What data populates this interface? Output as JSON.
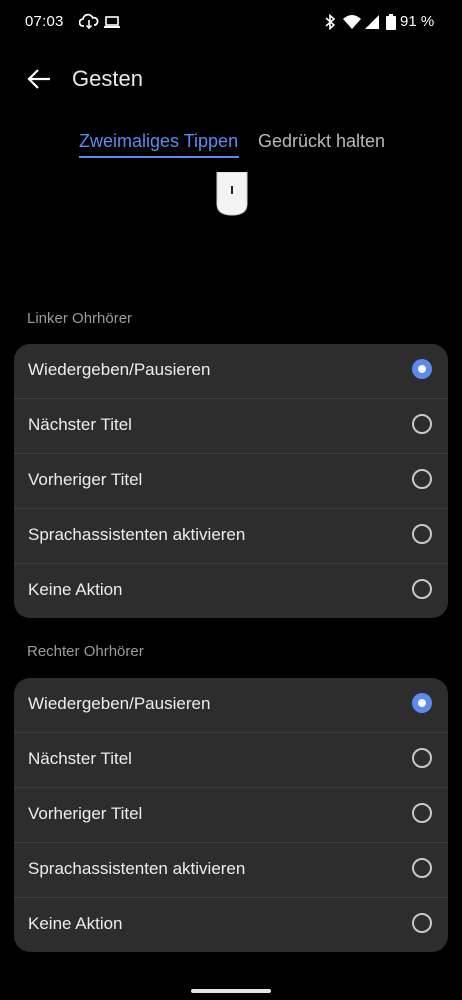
{
  "status_bar": {
    "time": "07:03",
    "left_icons": [
      "cloud-sync-icon",
      "laptop-icon"
    ],
    "right_icons": [
      "bluetooth-icon",
      "wifi-icon",
      "signal-icon",
      "battery-icon"
    ],
    "battery": "91 %"
  },
  "app_bar": {
    "back_icon": "arrow-left-icon",
    "title": "Gesten"
  },
  "tabs": [
    {
      "label": "Zweimaliges Tippen",
      "active": true
    },
    {
      "label": "Gedrückt halten",
      "active": false
    }
  ],
  "sections": [
    {
      "label": "Linker Ohrhörer",
      "options": [
        {
          "label": "Wiedergeben/Pausieren",
          "selected": true
        },
        {
          "label": "Nächster Titel",
          "selected": false
        },
        {
          "label": "Vorheriger Titel",
          "selected": false
        },
        {
          "label": "Sprachassistenten aktivieren",
          "selected": false
        },
        {
          "label": "Keine Aktion",
          "selected": false
        }
      ]
    },
    {
      "label": "Rechter Ohrhörer",
      "options": [
        {
          "label": "Wiedergeben/Pausieren",
          "selected": true
        },
        {
          "label": "Nächster Titel",
          "selected": false
        },
        {
          "label": "Vorheriger Titel",
          "selected": false
        },
        {
          "label": "Sprachassistenten aktivieren",
          "selected": false
        },
        {
          "label": "Keine Aktion",
          "selected": false
        }
      ]
    }
  ],
  "colors": {
    "accent": "#5b8bf1",
    "background": "#000000",
    "card": "#2d2d2d"
  }
}
